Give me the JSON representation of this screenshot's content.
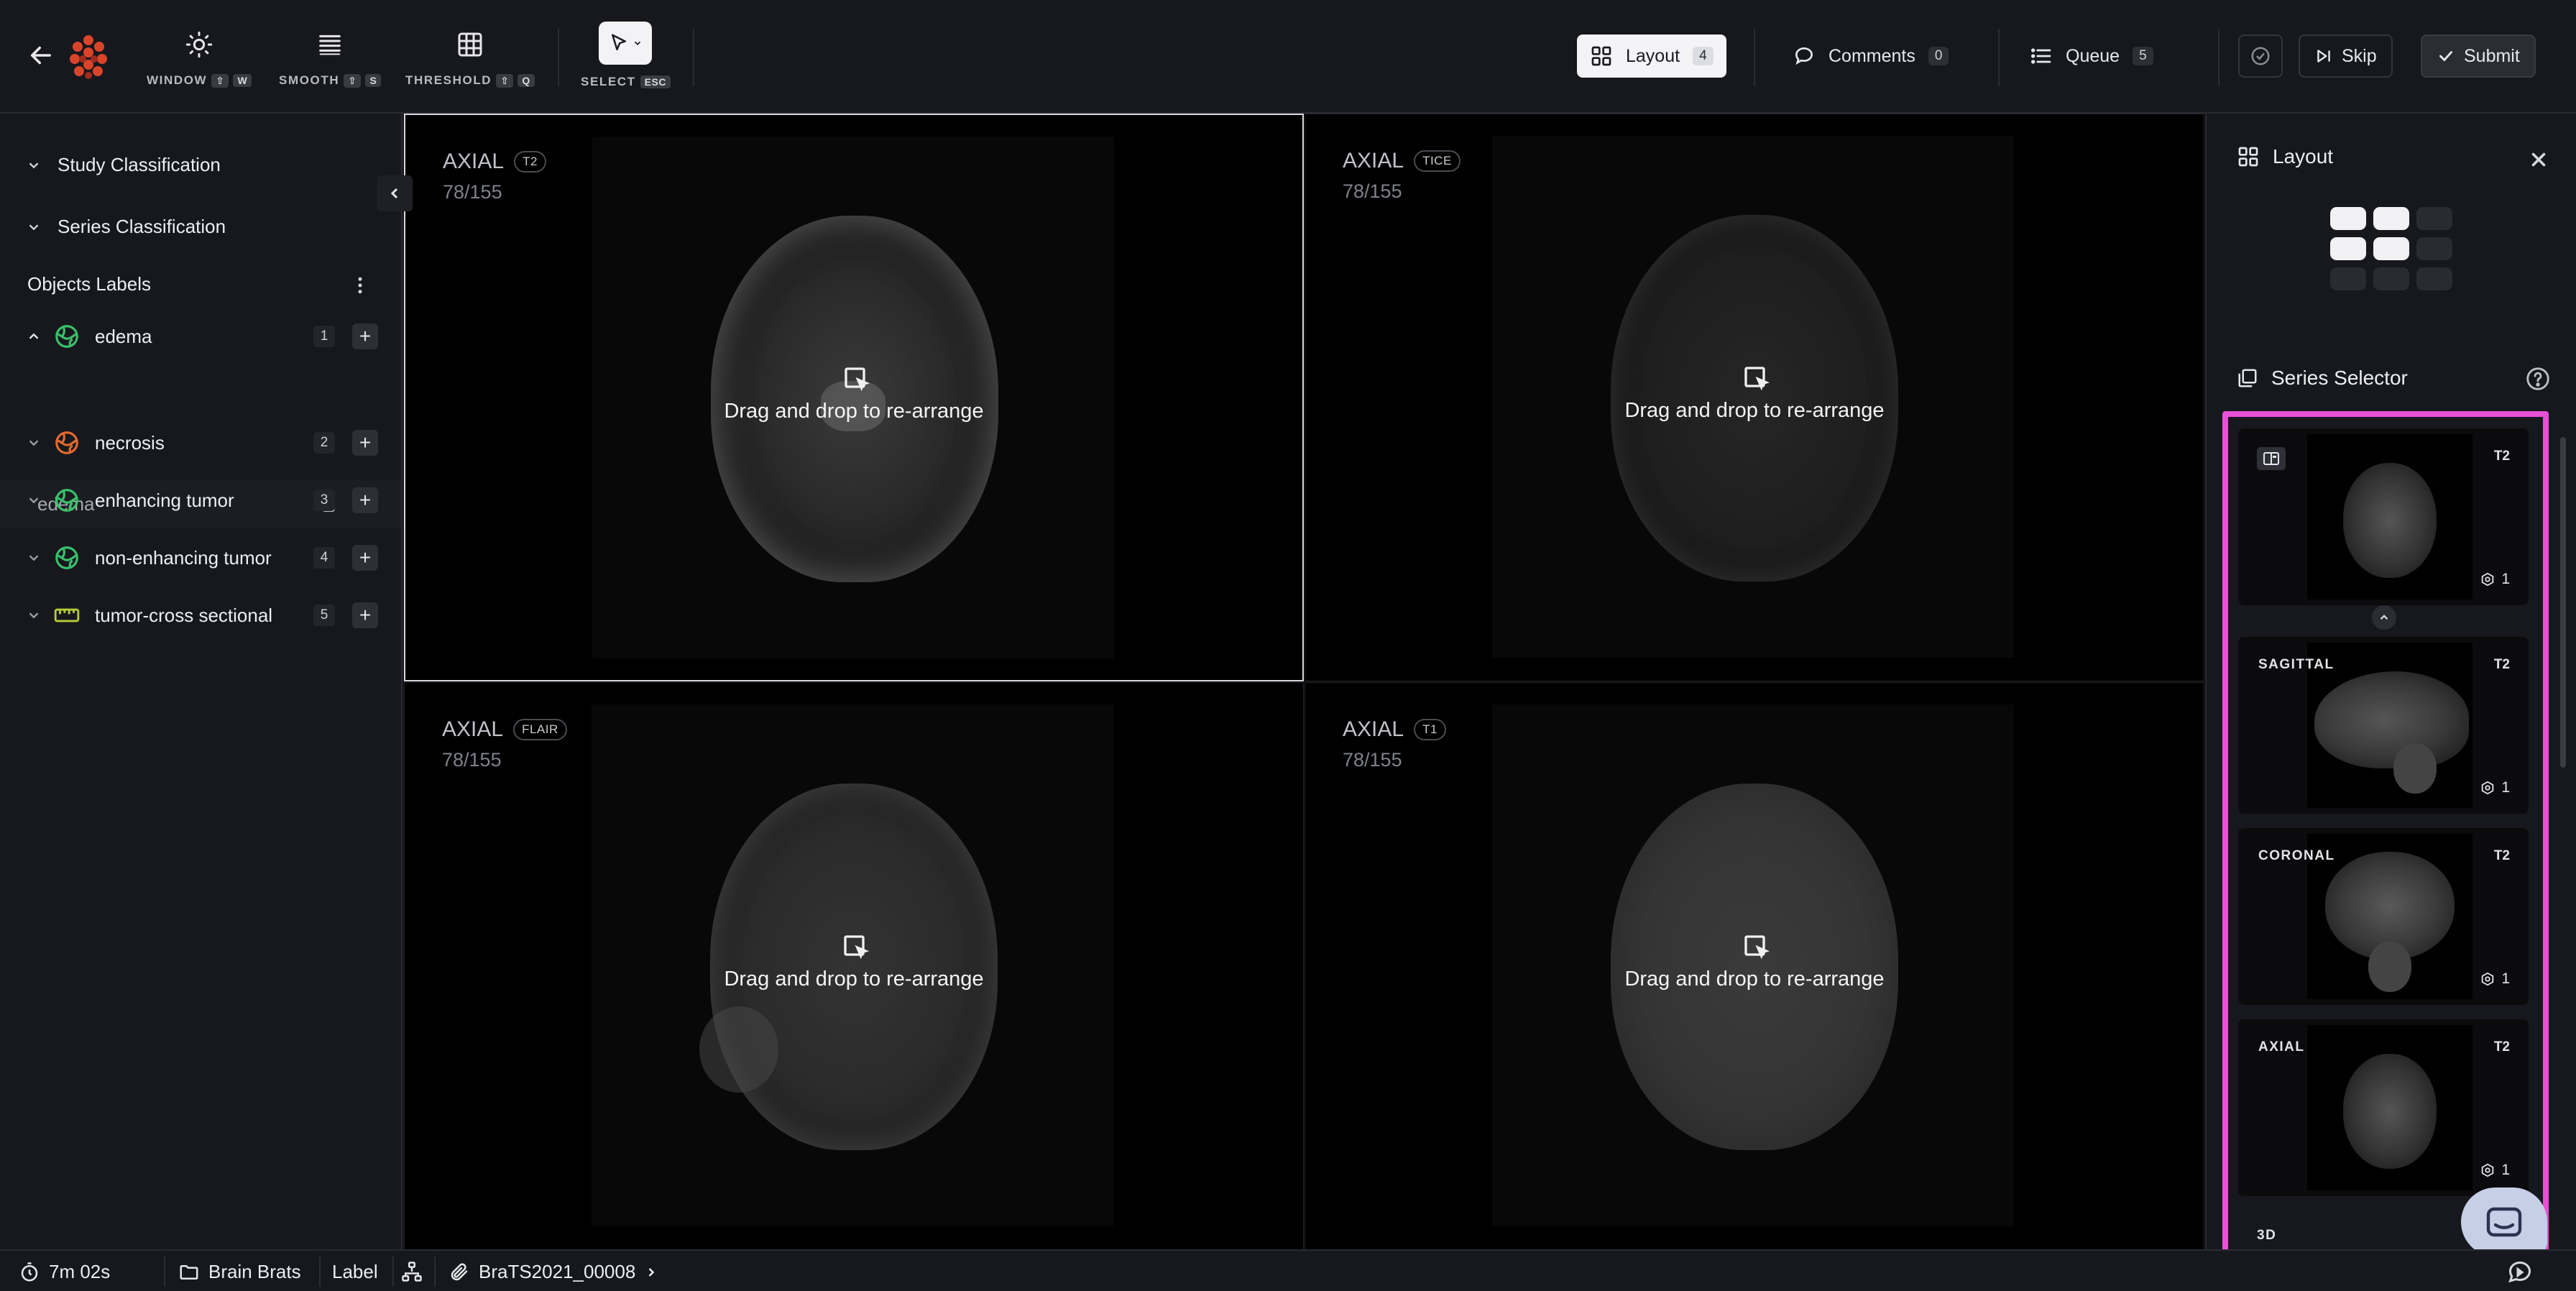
{
  "topbar": {
    "tools": [
      {
        "label": "WINDOW",
        "keys": [
          "⇧",
          "W"
        ],
        "icon": "sun-icon"
      },
      {
        "label": "SMOOTH",
        "keys": [
          "⇧",
          "S"
        ],
        "icon": "lines-icon"
      },
      {
        "label": "THRESHOLD",
        "keys": [
          "⇧",
          "Q"
        ],
        "icon": "grid-icon"
      },
      {
        "label": "SELECT",
        "keys": [
          "ESC"
        ],
        "icon": "cursor-icon"
      }
    ],
    "layout_btn": {
      "label": "Layout",
      "count": "4"
    },
    "comments_btn": {
      "label": "Comments",
      "count": "0"
    },
    "queue_btn": {
      "label": "Queue",
      "count": "5"
    },
    "skip_label": "Skip",
    "submit_label": "Submit"
  },
  "sidebar": {
    "study_classification": "Study Classification",
    "series_classification": "Series Classification",
    "objects_labels": "Objects Labels",
    "labels": [
      {
        "name": "edema",
        "num": "1",
        "color": "#39c06a"
      },
      {
        "name": "necrosis",
        "num": "2",
        "color": "#e06a2f"
      },
      {
        "name": "enhancing tumor",
        "num": "3",
        "color": "#39c06a"
      },
      {
        "name": "non-enhancing tumor",
        "num": "4",
        "color": "#39c06a"
      },
      {
        "name": "tumor-cross sectional",
        "num": "5",
        "color": "#b8cc3a"
      }
    ],
    "instance": {
      "name": "edema"
    }
  },
  "viewports": [
    {
      "plane": "AXIAL",
      "seq": "T2",
      "slice": "78/155",
      "dnd": "Drag and drop to re-arrange"
    },
    {
      "plane": "AXIAL",
      "seq": "TICE",
      "slice": "78/155",
      "dnd": "Drag and drop to re-arrange"
    },
    {
      "plane": "AXIAL",
      "seq": "FLAIR",
      "slice": "78/155",
      "dnd": "Drag and drop to re-arrange"
    },
    {
      "plane": "AXIAL",
      "seq": "T1",
      "slice": "78/155",
      "dnd": "Drag and drop to re-arrange"
    }
  ],
  "right_panel": {
    "layout_title": "Layout",
    "series_selector_title": "Series Selector",
    "cards": [
      {
        "plane": "",
        "seq": "T2",
        "count": "1"
      },
      {
        "plane": "SAGITTAL",
        "seq": "T2",
        "count": "1"
      },
      {
        "plane": "CORONAL",
        "seq": "T2",
        "count": "1"
      },
      {
        "plane": "AXIAL",
        "seq": "T2",
        "count": "1"
      }
    ],
    "tail_label": "3D"
  },
  "bottombar": {
    "timer": "7m 02s",
    "project": "Brain Brats",
    "mode": "Label",
    "case": "BraTS2021_00008"
  }
}
